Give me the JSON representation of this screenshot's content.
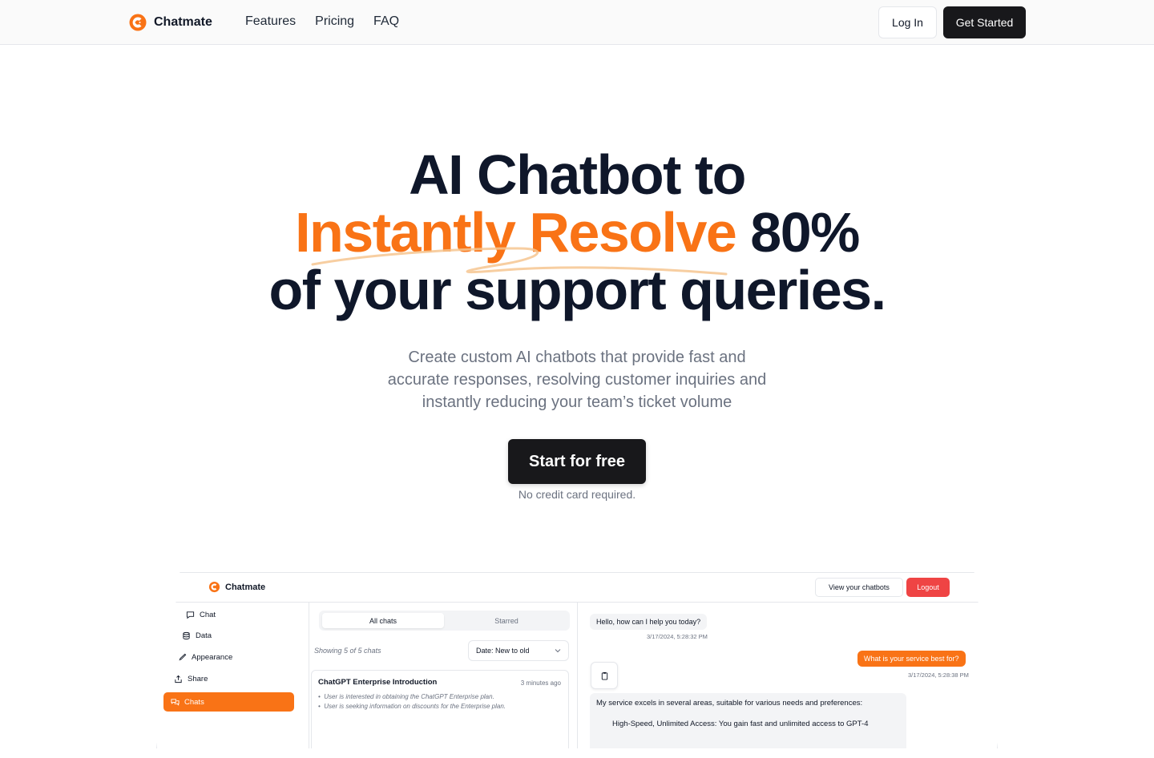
{
  "nav": {
    "brand": "Chatmate",
    "links": [
      "Features",
      "Pricing",
      "FAQ"
    ],
    "login": "Log In",
    "get_started": "Get Started"
  },
  "hero": {
    "line1": "AI Chatbot to",
    "line2_highlight": "Instantly Resolve",
    "line2_rest": "80%",
    "line3": "of your support queries.",
    "subtitle": "Create custom AI chatbots that provide fast and accurate responses, resolving customer inquiries and instantly reducing your team’s ticket volume",
    "cta": "Start for free",
    "note": "No credit card required."
  },
  "preview": {
    "brand": "Chatmate",
    "view_chatbots": "View your chatbots",
    "logout": "Logout",
    "sidebar": [
      "Chat",
      "Data",
      "Appearance",
      "Share",
      "Chats"
    ],
    "tabs": [
      "All chats",
      "Starred"
    ],
    "showing": "Showing 5 of 5 chats",
    "sort": "Date: New to old",
    "card": {
      "title": "ChatGPT Enterprise Introduction",
      "time": "3 minutes ago",
      "bullets": [
        "User is interested in obtaining the ChatGPT Enterprise plan.",
        "User is seeking information on discounts for the Enterprise plan."
      ]
    },
    "messages": {
      "bot": "Hello, how can I help you today?",
      "bot_time": "3/17/2024, 5:28:32 PM",
      "user": "What is your service best for?",
      "user_time": "3/17/2024, 5:28:38 PM",
      "reply": "My service excels in several areas, suitable for various needs and preferences:",
      "reply_item": "High-Speed, Unlimited Access: You gain fast and unlimited access to GPT-4"
    }
  },
  "colors": {
    "accent": "#f97316",
    "dark": "#18181b",
    "danger": "#ef4444"
  }
}
